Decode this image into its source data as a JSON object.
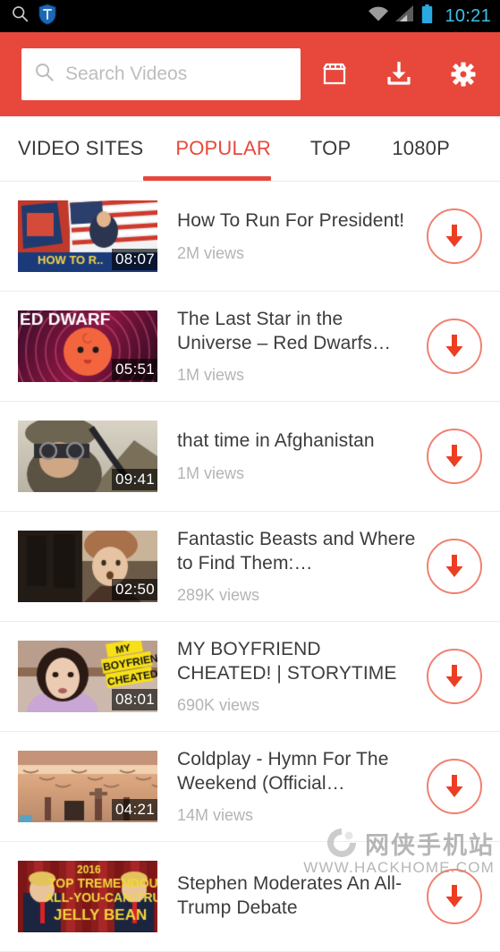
{
  "statusbar": {
    "left_icons": [
      "search-icon",
      "shield-icon"
    ],
    "right_icons": [
      "wifi-icon",
      "signal-icon",
      "battery-icon"
    ],
    "time": "10:21",
    "time_color": "#3ec1e8",
    "background": "#000000"
  },
  "toolbar": {
    "background": "#e8483c",
    "search": {
      "value": "",
      "placeholder": "Search Videos",
      "icon": "search-icon"
    },
    "actions": [
      {
        "name": "store-button",
        "icon": "store-icon"
      },
      {
        "name": "downloads-button",
        "icon": "download-icon"
      },
      {
        "name": "settings-button",
        "icon": "gear-icon"
      }
    ]
  },
  "tabs": {
    "active_index": 1,
    "accent": "#e8483c",
    "items": [
      {
        "label": "VIDEO SITES"
      },
      {
        "label": "POPULAR"
      },
      {
        "label": "TOP"
      },
      {
        "label": "1080P"
      }
    ]
  },
  "videos": [
    {
      "title": "How To Run For President!",
      "views": "2M views",
      "duration": "08:07",
      "thumb": "how-to-run-for-president-thumbnail",
      "download": "download-button"
    },
    {
      "title": "The Last Star in the Universe – Red Dwarfs…",
      "views": "1M views",
      "duration": "05:51",
      "thumb": "red-dwarfs-thumbnail",
      "download": "download-button"
    },
    {
      "title": "that time in Afghanistan",
      "views": "1M views",
      "duration": "09:41",
      "thumb": "afghanistan-thumbnail",
      "download": "download-button"
    },
    {
      "title": "Fantastic Beasts and Where to Find Them:…",
      "views": "289K views",
      "duration": "02:50",
      "thumb": "fantastic-beasts-thumbnail",
      "download": "download-button"
    },
    {
      "title": "MY BOYFRIEND CHEATED! | STORYTIME",
      "views": "690K views",
      "duration": "08:01",
      "thumb": "my-boyfriend-cheated-thumbnail",
      "download": "download-button"
    },
    {
      "title": "Coldplay - Hymn For The Weekend (Official…",
      "views": "14M views",
      "duration": "04:21",
      "thumb": "coldplay-hymn-thumbnail",
      "download": "download-button"
    },
    {
      "title": "Stephen Moderates An All-Trump Debate",
      "views": "",
      "duration": "",
      "thumb": "all-trump-debate-thumbnail",
      "download": "download-button"
    }
  ],
  "watermark": {
    "chinese": "网侠手机站",
    "url": "WWW.HACKHOME.COM"
  }
}
